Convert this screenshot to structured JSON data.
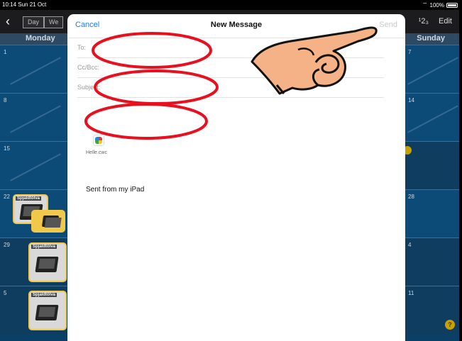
{
  "status_bar": {
    "time_date": "10:14  Sun 21 Oct",
    "battery": "100%"
  },
  "calendar": {
    "view_buttons": [
      "Day",
      "We"
    ],
    "right_buttons": [
      "¹2₃",
      "Edit"
    ],
    "day_headers": {
      "left": "Monday",
      "right": "Sunday"
    },
    "rows": [
      {
        "left_num": "1",
        "right_num": "7",
        "left_label": ""
      },
      {
        "left_num": "8",
        "right_num": "14",
        "left_label": ""
      },
      {
        "left_num": "15",
        "right_num": "",
        "left_label": ""
      },
      {
        "left_num": "22",
        "right_num": "28",
        "left_label": "Spjaldtölva"
      },
      {
        "left_num": "29",
        "right_num": "4",
        "left_label": "Spjaldtölva"
      },
      {
        "left_num": "5",
        "right_num": "11",
        "left_label": "Spjaldtölva"
      }
    ],
    "help_icon": "?"
  },
  "compose": {
    "cancel_label": "Cancel",
    "title": "New Message",
    "send_label": "Send",
    "fields": {
      "to_label": "To:",
      "cc_label": "Cc/Bcc:",
      "subject_label": "Subject:"
    },
    "attachment": {
      "filename": "Helle.cwc",
      "icon": "app-icon"
    },
    "body": "Sent from my iPad"
  },
  "annotations": {
    "red_ellipses": 3,
    "hand_pointer": "pointing-hand-icon",
    "highlight_color": "#e8101e",
    "hand_color": "#f5b287"
  }
}
